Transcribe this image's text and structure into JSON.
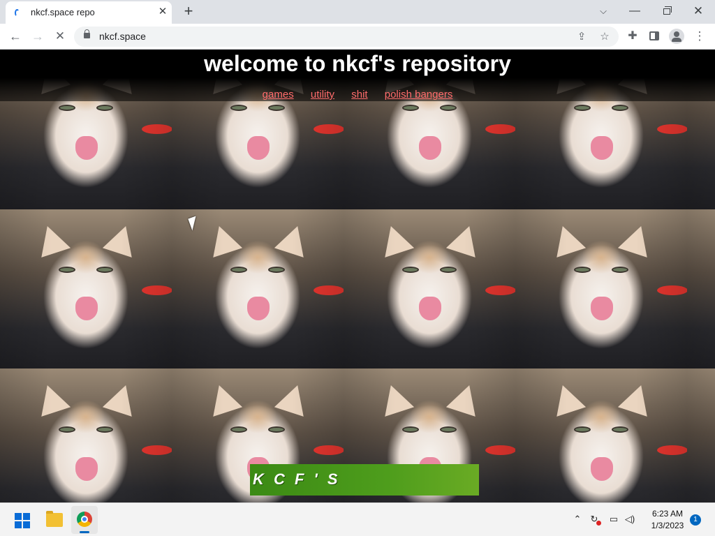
{
  "browser": {
    "tab_title": "nkcf.space repo",
    "url": "nkcf.space",
    "icons": [
      "tab-favicon-icon",
      "close-icon",
      "plus-icon",
      "chevron-down-icon",
      "minimize-icon",
      "restore-icon",
      "close-window-icon",
      "back-arrow-icon",
      "forward-arrow-icon",
      "stop-icon",
      "lock-icon",
      "share-icon",
      "star-icon",
      "puzzle-icon",
      "side-panel-icon",
      "profile-icon",
      "kebab-menu-icon"
    ]
  },
  "page": {
    "title": "welcome to nkcf's repository",
    "nav": [
      "games",
      "utility",
      "shit",
      "polish bangers"
    ],
    "link_color": "#ff6b6b",
    "banner_text": "K C F ' S",
    "banner_color": "#4e9d1c"
  },
  "taskbar": {
    "time": "6:23 AM",
    "date": "1/3/2023",
    "notification_count": "1",
    "icons": [
      "windows-start-icon",
      "file-explorer-icon",
      "chrome-icon",
      "chevron-up-icon",
      "sync-icon",
      "network-icon",
      "volume-icon"
    ]
  },
  "glyphs": {
    "tab_close": "✕",
    "new_tab": "+",
    "tab_search": "⌵",
    "minimize": "—",
    "close_window": "✕",
    "back": "←",
    "forward": "→",
    "stop": "✕",
    "share": "⇪",
    "star": "☆",
    "extensions": "✚",
    "menu": "⋮",
    "chevron_up": "⌃",
    "sync": "↻",
    "network": "▭",
    "volume": "◁)"
  }
}
